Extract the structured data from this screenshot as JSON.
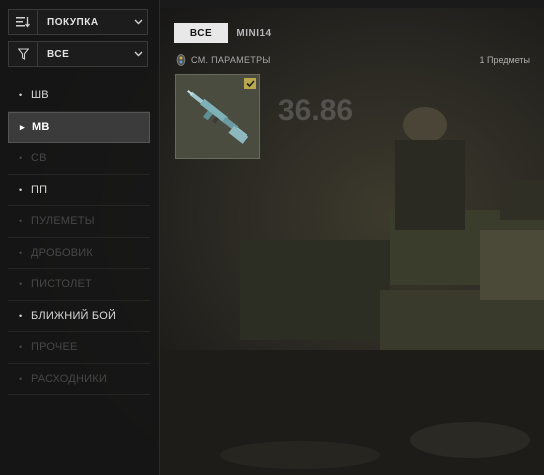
{
  "purchase_dropdown": {
    "label": "ПОКУПКА",
    "icon": "sort-icon"
  },
  "filter_dropdown": {
    "label": "ВСЕ",
    "icon": "filter-icon"
  },
  "categories": [
    {
      "label": "ШВ",
      "state": "normal"
    },
    {
      "label": "МВ",
      "state": "selected"
    },
    {
      "label": "СВ",
      "state": "disabled"
    },
    {
      "label": "ПП",
      "state": "normal"
    },
    {
      "label": "ПУЛЕМЕТЫ",
      "state": "disabled"
    },
    {
      "label": "ДРОБОВИК",
      "state": "disabled"
    },
    {
      "label": "ПИСТОЛЕТ",
      "state": "disabled"
    },
    {
      "label": "БЛИЖНИЙ БОЙ",
      "state": "normal"
    },
    {
      "label": "ПРОЧЕЕ",
      "state": "disabled"
    },
    {
      "label": "РАСХОДНИКИ",
      "state": "disabled"
    }
  ],
  "tabs": [
    {
      "label": "ВСЕ",
      "active": true
    },
    {
      "label": "MINI14",
      "active": false
    }
  ],
  "params_link": "СМ. ПАРАМЕТРЫ",
  "item_count": "1 Предметы",
  "item": {
    "name": "MINI14",
    "equipped": true,
    "icon": "rifle-icon"
  },
  "background_sign": "36.86",
  "colors": {
    "selected_bg": "#3b3b3b",
    "active_tab_bg": "#e8e8e8",
    "check_badge": "#b9a84c",
    "card_bg": "#4a4c40"
  }
}
